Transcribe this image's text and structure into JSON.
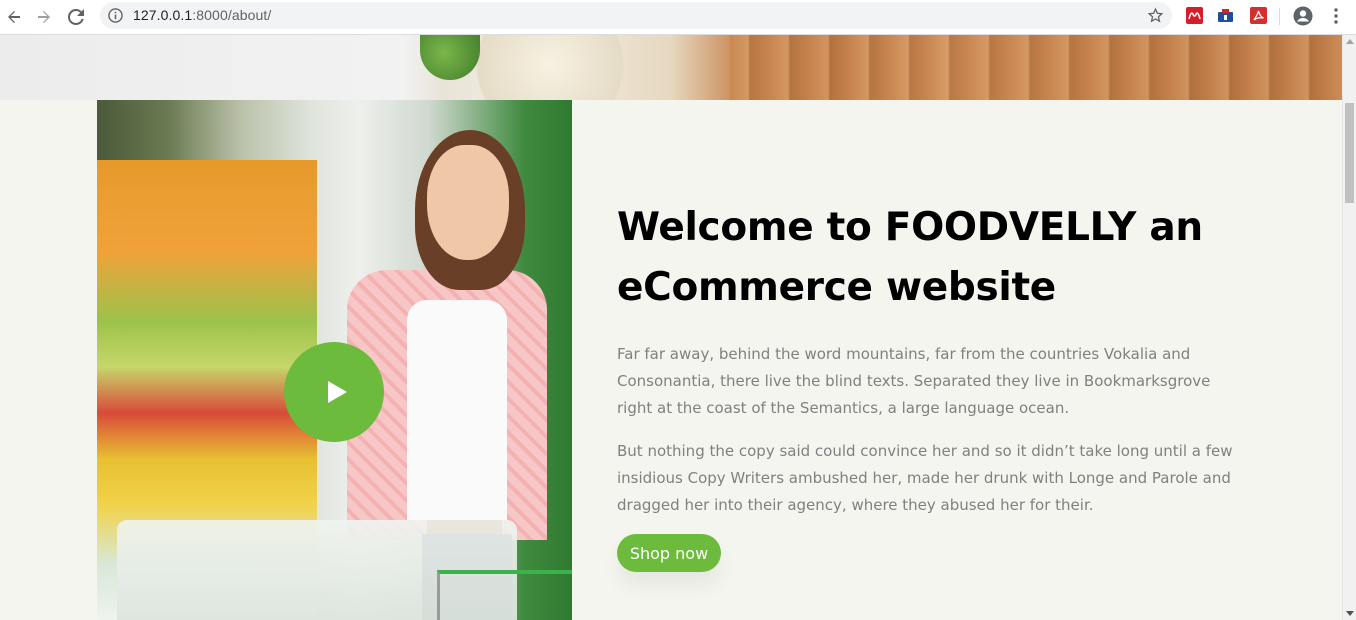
{
  "browser": {
    "url_host": "127.0.0.1",
    "url_rest": ":8000/about/",
    "extensions": [
      "mendeley-icon",
      "onetab-icon",
      "adobe-acrobat-icon"
    ]
  },
  "about": {
    "title": "Welcome to FOODVELLY an eCommerce website",
    "paragraph_1": "Far far away, behind the word mountains, far from the countries Vokalia and Consonantia, there live the blind texts. Separated they live in Bookmarksgrove right at the coast of the Semantics, a large language ocean.",
    "paragraph_2": "But nothing the copy said could convince her and so it didn’t take long until a few insidious Copy Writers ambushed her, made her drunk with Longe and Parole and dragged her into their agency, where they abused her for their.",
    "shop_button": "Shop now"
  },
  "colors": {
    "accent": "#6cbb3c",
    "page_background": "#f4f5ef",
    "heading": "#000000",
    "body_text": "#808080"
  }
}
